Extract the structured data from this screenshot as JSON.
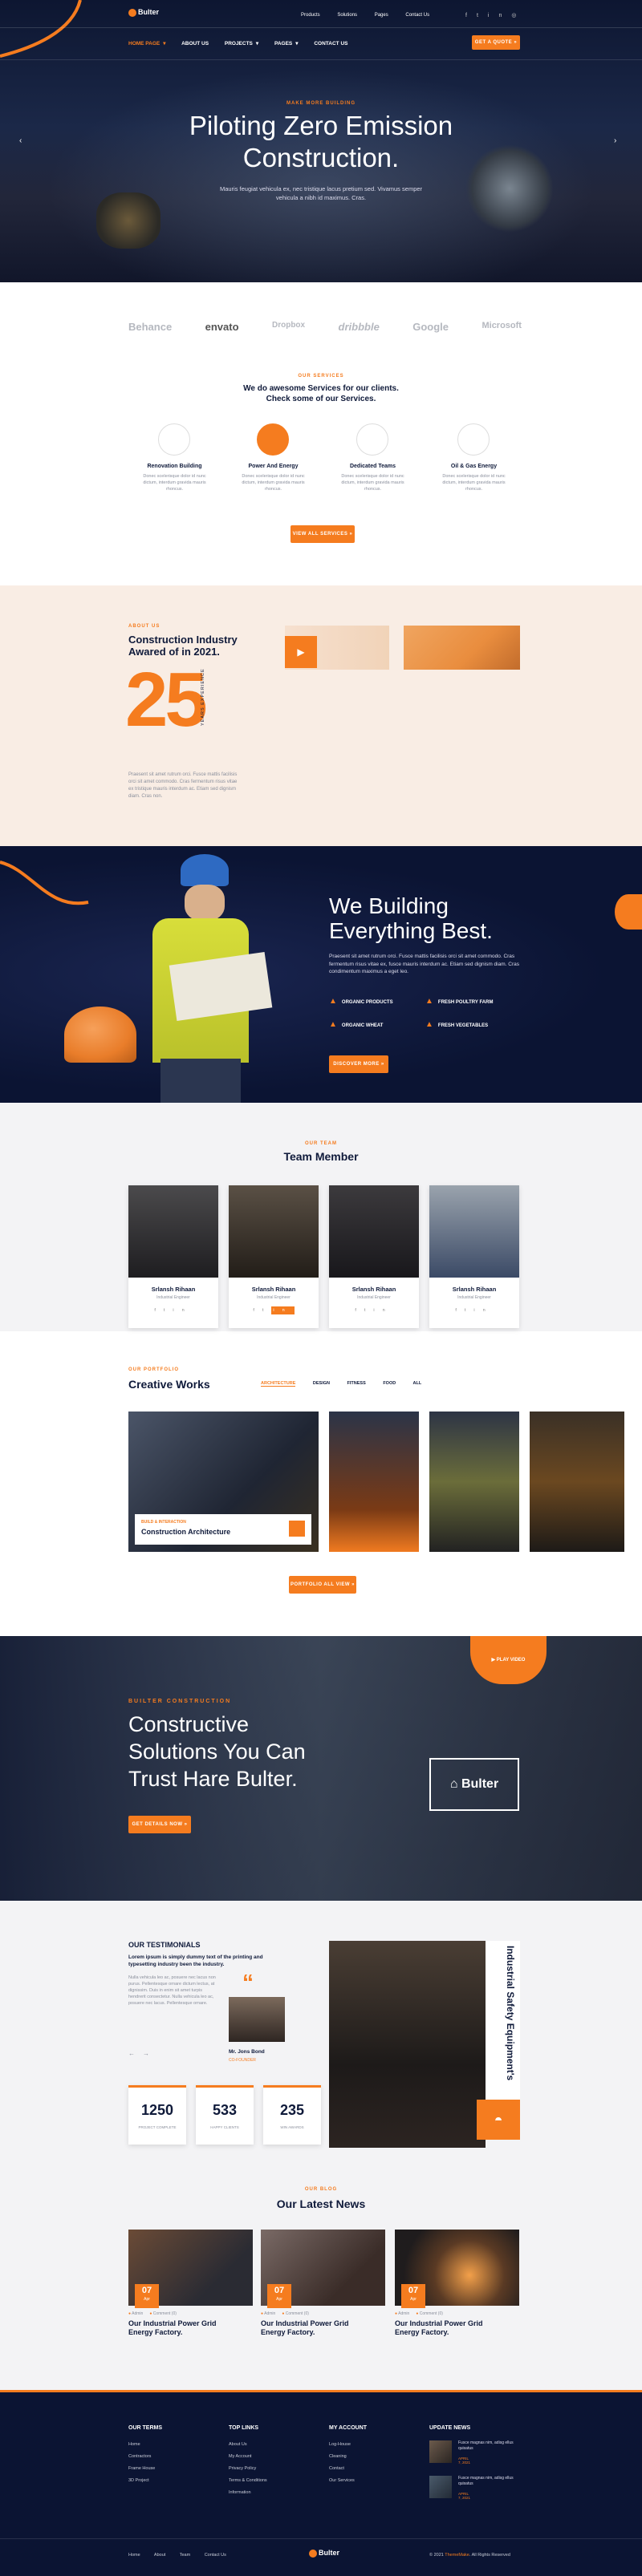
{
  "colors": {
    "accent": "#f57c1f",
    "navy": "#0b1433"
  },
  "topbar": {
    "links": [
      "Products",
      "Solutions",
      "Pages",
      "Contact Us"
    ]
  },
  "nav": {
    "logo": "Bulter",
    "items": [
      "HOME PAGE",
      "ABOUT US",
      "PROJECTS",
      "PAGES",
      "CONTACT US"
    ],
    "cta": "GET A QUOTE"
  },
  "hero": {
    "kicker": "MAKE MORE BUILDING",
    "title_1": "Piloting Zero Emission",
    "title_2": "Construction.",
    "text_1": "Mauris feugiat vehicula ex, nec tristique lacus pretium sed. Vivamus semper",
    "text_2": "vehicula a nibh id maximus. Cras."
  },
  "brands": [
    "Behance",
    "envato",
    "Dropbox",
    "dribbble",
    "Google",
    "Microsoft"
  ],
  "services": {
    "kicker": "OUR SERVICES",
    "title_1": "We do awesome Services for our clients.",
    "title_2": "Check some of our Services.",
    "items": [
      {
        "title": "Renovation Building",
        "text": "Donec scelerisque dolor id nunc dictum, interdum gravida mauris rhoncus."
      },
      {
        "title": "Power And Energy",
        "text": "Donec scelerisque dolor id nunc dictum, interdum gravida mauris rhoncus."
      },
      {
        "title": "Dedicated Teams",
        "text": "Donec scelerisque dolor id nunc dictum, interdum gravida mauris rhoncus."
      },
      {
        "title": "Oil & Gas Energy",
        "text": "Donec scelerisque dolor id nunc dictum, interdum gravida mauris rhoncus."
      }
    ],
    "button": "VIEW ALL SERVICES"
  },
  "about": {
    "kicker": "ABOUT US",
    "title_1": "Construction Industry",
    "title_2": "Awared of in 2021.",
    "number": "25",
    "years": "YEARS EXPERIENCE",
    "text": "Praesent sit amet rutrum orci. Fusce mattis facilisis orci sit amet commodo. Cras fermentum risus vitae ex tristique mauris interdum ac. Etiam sed dignism diam. Cras non."
  },
  "building": {
    "title_1": "We Building",
    "title_2": "Everything Best.",
    "text": "Praesent sit amet rutrum orci. Fusce mattis facilisis orci sit amet commodo. Cras fermentum risus vitae ex, fusce mauris interdum ac. Etiam sed dignism diam. Cras condimentum maximus a eget leo.",
    "features": [
      "ORGANIC PRODUCTS",
      "FRESH POULTRY FARM",
      "ORGANIC WHEAT",
      "FRESH VEGETABLES"
    ],
    "button": "DISCOVER MORE"
  },
  "team": {
    "kicker": "OUR TEAM",
    "title": "Team Member",
    "members": [
      {
        "name": "Srlansh Rihaan",
        "role": "Industrial Engineer"
      },
      {
        "name": "Srlansh Rihaan",
        "role": "Industrial Engineer"
      },
      {
        "name": "Srlansh Rihaan",
        "role": "Industrial Engineer"
      },
      {
        "name": "Srlansh Rihaan",
        "role": "Industrial Engineer"
      }
    ]
  },
  "portfolio": {
    "kicker": "OUR PORTFOLIO",
    "title": "Creative Works",
    "filters": [
      "ARCHITECTURE",
      "DESIGN",
      "FITNESS",
      "FOOD",
      "ALL"
    ],
    "card_kicker": "BUILD & INTERACTION",
    "card_title": "Construction Architecture",
    "button": "PORTFOLIO ALL VIEW"
  },
  "cta": {
    "kicker": "BUILTER CONSTRUCTION",
    "title_1": "Constructive",
    "title_2": "Solutions You Can",
    "title_3": "Trust Hare Bulter.",
    "button": "GET DETAILS NOW",
    "video": "PLAY VIDEO",
    "logo": "Bulter"
  },
  "testimonials": {
    "title": "OUR TESTIMONIALS",
    "lead": "Lorem ipsum is simply dummy text of the printing and typesetting industry been the industry.",
    "body": "Nulla vehicula leo ac, posuere nec lacus non purus. Pellentesque ornare dictum lectus, at dignissim. Duis in enim sit amet turpis hendrerit consectetur. Nulla vehicula leo ac, posuere nec lacus. Pellentesque ornare.",
    "name": "Mr. Jons Bond",
    "role": "CO-FOUNDER",
    "side": "Industrial Safety Equipment's"
  },
  "stats": [
    {
      "value": "1250",
      "label": "PROJECT COMPLETE"
    },
    {
      "value": "533",
      "label": "HAPPY CLIENTS"
    },
    {
      "value": "235",
      "label": "WIN AWARDS"
    }
  ],
  "news": {
    "kicker": "OUR BLOG",
    "title": "Our Latest News",
    "posts": [
      {
        "day": "07",
        "month": "Apr",
        "author": "Admin",
        "comments": "Comment (0)",
        "title_1": "Our Industrial Power Grid",
        "title_2": "Energy Factory."
      },
      {
        "day": "07",
        "month": "Apr",
        "author": "Admin",
        "comments": "Comment (0)",
        "title_1": "Our Industrial Power Grid",
        "title_2": "Energy Factory."
      },
      {
        "day": "07",
        "month": "Apr",
        "author": "Admin",
        "comments": "Comment (0)",
        "title_1": "Our Industrial Power Grid",
        "title_2": "Energy Factory."
      }
    ]
  },
  "footer": {
    "cols": [
      {
        "title": "OUR TERMS",
        "links": [
          "Home",
          "Contractors",
          "Frame House",
          "3D Project"
        ]
      },
      {
        "title": "TOP LINKS",
        "links": [
          "About Us",
          "My Account",
          "Privacy Policy",
          "Terms & Conditions",
          "Information"
        ]
      },
      {
        "title": "MY ACCOUNT",
        "links": [
          "Log-House",
          "Cleaning",
          "Contact",
          "Our Services"
        ]
      }
    ],
    "updates_title": "UPDATE NEWS",
    "updates": [
      {
        "text": "Fusce magnas nim, adisg ellus quisatus",
        "date": "APRIL 7, 2021"
      },
      {
        "text": "Fusce magnas nim, adisg ellus quisatus",
        "date": "APRIL 7, 2021"
      }
    ],
    "bottom_links": [
      "Home",
      "About",
      "Team",
      "Contact Us"
    ],
    "copyright": "© 2021",
    "brand": "ThemeMake",
    "rights": "All Rights Reserved"
  }
}
